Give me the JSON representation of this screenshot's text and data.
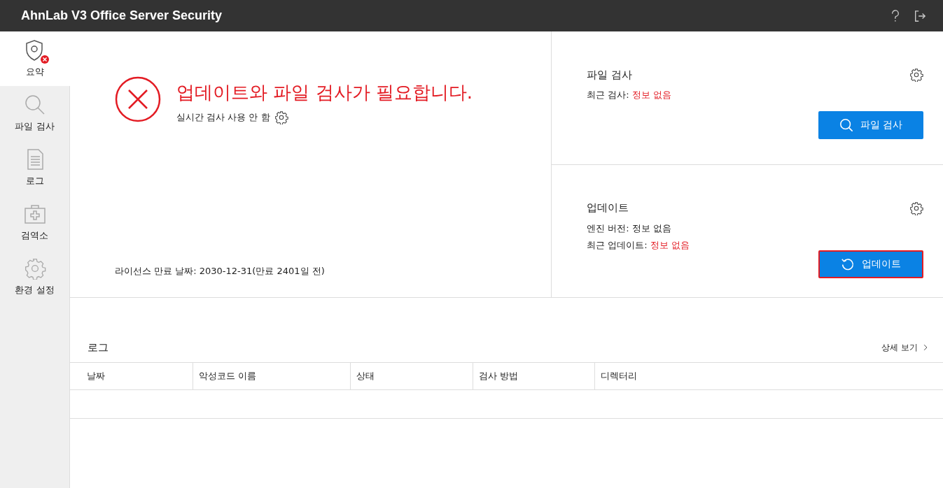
{
  "window": {
    "title": "AhnLab V3 Office Server Security"
  },
  "sidebar": {
    "items": [
      {
        "label": "요약",
        "selected": true,
        "alert": true
      },
      {
        "label": "파일 검사",
        "selected": false,
        "alert": false
      },
      {
        "label": "로그",
        "selected": false,
        "alert": false
      },
      {
        "label": "검역소",
        "selected": false,
        "alert": false
      },
      {
        "label": "환경 설정",
        "selected": false,
        "alert": false
      }
    ]
  },
  "status": {
    "headline": "업데이트와 파일 검사가 필요합니다.",
    "realtime": "실시간 검사 사용 안 함",
    "license": "라이선스 만료 날짜: 2030-12-31(만료 2401일 전)"
  },
  "cards": [
    {
      "title": "파일 검사",
      "rows": [
        {
          "label": "최근 검사:",
          "value": "정보 없음",
          "alert": true
        }
      ],
      "button": {
        "label": "파일 검사",
        "focused": false
      }
    },
    {
      "title": "업데이트",
      "rows": [
        {
          "label": "엔진 버전:",
          "value": "정보 없음",
          "alert": false
        },
        {
          "label": "최근 업데이트:",
          "value": "정보 없음",
          "alert": true
        }
      ],
      "button": {
        "label": "업데이트",
        "focused": true
      }
    }
  ],
  "log": {
    "title": "로그",
    "more": "상세 보기",
    "columns": [
      "날짜",
      "악성코드 이름",
      "상태",
      "검사 방법",
      "디렉터리"
    ]
  }
}
